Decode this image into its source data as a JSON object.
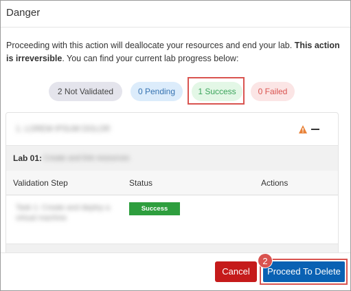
{
  "dialog": {
    "title": "Danger",
    "message_part1": "Proceeding with this action will deallocate your resources and end your lab. ",
    "message_bold": "This action is irreversible",
    "message_part2": ". You can find your current lab progress below:"
  },
  "summary": {
    "not_validated": "2 Not Validated",
    "pending": "0 Pending",
    "success": "1 Success",
    "failed": "0 Failed"
  },
  "card": {
    "title": "1. LOREM IPSUM DOLOR",
    "lab_label": "Lab 01: ",
    "lab_name": "Create and link resources",
    "table": {
      "headers": [
        "Validation Step",
        "Status",
        "Actions"
      ],
      "rows": [
        {
          "step": "Task 1: Create and deploy a virtual machine",
          "status": "Success"
        }
      ]
    }
  },
  "footer": {
    "cancel_label": "Cancel",
    "proceed_label": "Proceed To Delete",
    "step_marker": "2"
  },
  "colors": {
    "cancel": "#c51b1b",
    "proceed": "#0a61b3",
    "success": "#2e9e3e",
    "annotation": "#d9534f",
    "warning": "#e8833a"
  },
  "icons": [
    "warning-triangle-icon",
    "minus-icon"
  ]
}
